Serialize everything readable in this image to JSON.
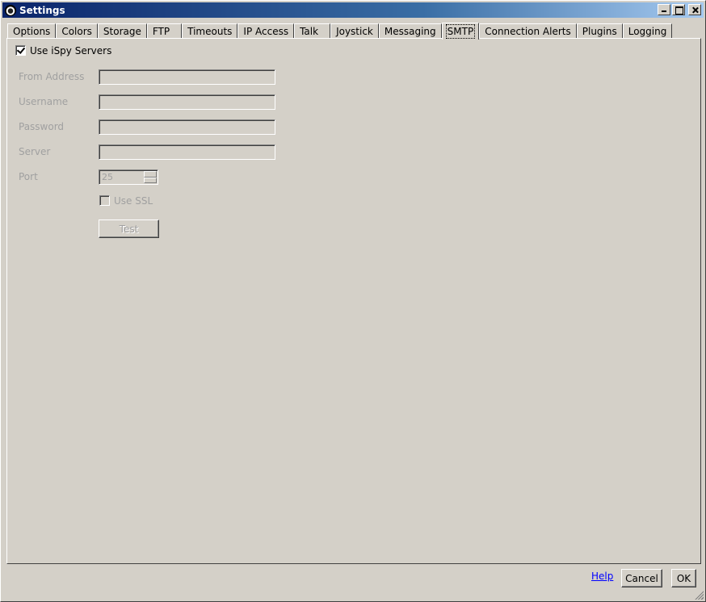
{
  "window": {
    "title": "Settings",
    "controls": [
      "minimize-icon",
      "maximize-icon",
      "close-icon"
    ]
  },
  "tabs": [
    {
      "label": "Options"
    },
    {
      "label": "Colors"
    },
    {
      "label": "Storage"
    },
    {
      "label": "FTP"
    },
    {
      "label": "Timeouts"
    },
    {
      "label": "IP Access"
    },
    {
      "label": "Talk"
    },
    {
      "label": "Joystick"
    },
    {
      "label": "Messaging"
    },
    {
      "label": "SMTP",
      "active": true
    },
    {
      "label": "Connection Alerts"
    },
    {
      "label": "Plugins"
    },
    {
      "label": "Logging"
    }
  ],
  "smtp": {
    "use_ispy_servers": {
      "label": "Use iSpy Servers",
      "checked": true
    },
    "from_address": {
      "label": "From Address",
      "value": ""
    },
    "username": {
      "label": "Username",
      "value": ""
    },
    "password": {
      "label": "Password",
      "value": ""
    },
    "server": {
      "label": "Server",
      "value": ""
    },
    "port": {
      "label": "Port",
      "value": "25"
    },
    "use_ssl": {
      "label": "Use SSL",
      "checked": false
    },
    "test_button": "Test"
  },
  "footer": {
    "help_link": "Help",
    "cancel_button": "Cancel",
    "ok_button": "OK"
  }
}
